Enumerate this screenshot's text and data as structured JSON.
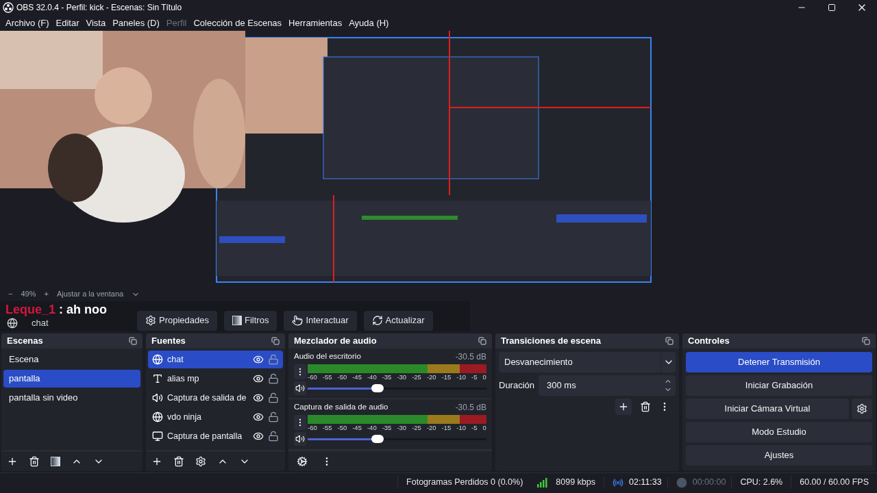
{
  "window": {
    "title": "OBS 32.0.4 - Perfil: kick - Escenas: Sin Título"
  },
  "menu": [
    {
      "label": "Archivo (F)",
      "disabled": false
    },
    {
      "label": "Editar",
      "disabled": false
    },
    {
      "label": "Vista",
      "disabled": false
    },
    {
      "label": "Paneles (D)",
      "disabled": false
    },
    {
      "label": "Perfil",
      "disabled": true
    },
    {
      "label": "Colección de Escenas",
      "disabled": false
    },
    {
      "label": "Herramientas",
      "disabled": false
    },
    {
      "label": "Ayuda (H)",
      "disabled": false
    }
  ],
  "zoom_bar": {
    "minus": "−",
    "zoom": "49%",
    "plus": "+",
    "fit": "Ajustar a la ventana"
  },
  "chat_overlay": {
    "user": "Leque_1",
    "message": ": ah noo"
  },
  "source_toolbar": {
    "source": "chat",
    "buttons": [
      {
        "label": "Propiedades",
        "kind": "properties"
      },
      {
        "label": "Filtros",
        "kind": "filters"
      },
      {
        "label": "Interactuar",
        "kind": "interact"
      },
      {
        "label": "Actualizar",
        "kind": "refresh"
      }
    ]
  },
  "scenes": {
    "title": "Escenas",
    "items": [
      {
        "label": "Escena",
        "selected": false
      },
      {
        "label": "pantalla",
        "selected": true
      },
      {
        "label": "pantalla sin video",
        "selected": false
      }
    ]
  },
  "sources": {
    "title": "Fuentes",
    "items": [
      {
        "label": "chat",
        "kind": "browser",
        "selected": true,
        "visible": true,
        "locked": false
      },
      {
        "label": "alias mp",
        "kind": "text",
        "selected": false,
        "visible": true,
        "locked": false
      },
      {
        "label": "Captura de salida de",
        "kind": "audio",
        "selected": false,
        "visible": true,
        "locked": false
      },
      {
        "label": "vdo ninja",
        "kind": "browser",
        "selected": false,
        "visible": true,
        "locked": false
      },
      {
        "label": "Captura de pantalla",
        "kind": "display",
        "selected": false,
        "visible": true,
        "locked": false
      }
    ]
  },
  "mixer": {
    "title": "Mezclador de audio",
    "channels": [
      {
        "name": "Audio del escritorio",
        "reading": "-30.5 dB",
        "level": 0.37,
        "scale": [
          "-60",
          "-55",
          "-50",
          "-45",
          "-40",
          "-35",
          "-30",
          "-25",
          "-20",
          "-15",
          "-10",
          "-5",
          "0"
        ]
      },
      {
        "name": "Captura de salida de audio",
        "reading": "-30.5 dB",
        "level": 0.37,
        "scale": [
          "-60",
          "-55",
          "-50",
          "-45",
          "-40",
          "-35",
          "-30",
          "-25",
          "-20",
          "-15",
          "-10",
          "-5",
          "0"
        ]
      }
    ]
  },
  "transitions": {
    "title": "Transiciones de escena",
    "transition": "Desvanecimiento",
    "duration_label": "Duración",
    "duration": "300 ms"
  },
  "controls": {
    "title": "Controles",
    "buttons": [
      {
        "label": "Detener Transmisión",
        "active": true,
        "settings": false
      },
      {
        "label": "Iniciar Grabación",
        "active": false,
        "settings": false
      },
      {
        "label": "Iniciar Cámara Virtual",
        "active": false,
        "settings": true
      },
      {
        "label": "Modo Estudio",
        "active": false,
        "settings": false
      },
      {
        "label": "Ajustes",
        "active": false,
        "settings": false
      }
    ]
  },
  "status_bar": {
    "dropped": "Fotogramas Perdidos 0 (0.0%)",
    "bitrate": "8099 kbps",
    "streaming": true,
    "stream_time": "02:11:33",
    "recording": false,
    "record_time": "00:00:00",
    "cpu": "CPU: 2.6%",
    "fps": "60.00 / 60.00 FPS"
  }
}
